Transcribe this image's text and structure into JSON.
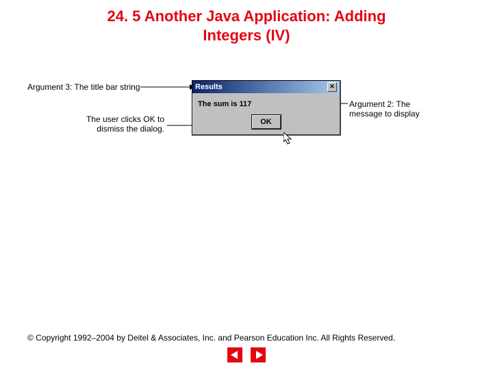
{
  "title_line1": "24. 5  Another Java Application: Adding",
  "title_line2": "Integers (IV)",
  "annotations": {
    "titlebar": "Argument 3: The title bar string",
    "ok_line1": "The user clicks OK to",
    "ok_line2": "dismiss the dialog.",
    "msg_line1": "Argument 2: The",
    "msg_line2": "message to display"
  },
  "dialog": {
    "title": "Results",
    "close_glyph": "✕",
    "message": "The sum is 117",
    "ok_label": "OK"
  },
  "copyright": "© Copyright 1992–2004 by Deitel & Associates, Inc. and Pearson Education Inc. All Rights Reserved."
}
